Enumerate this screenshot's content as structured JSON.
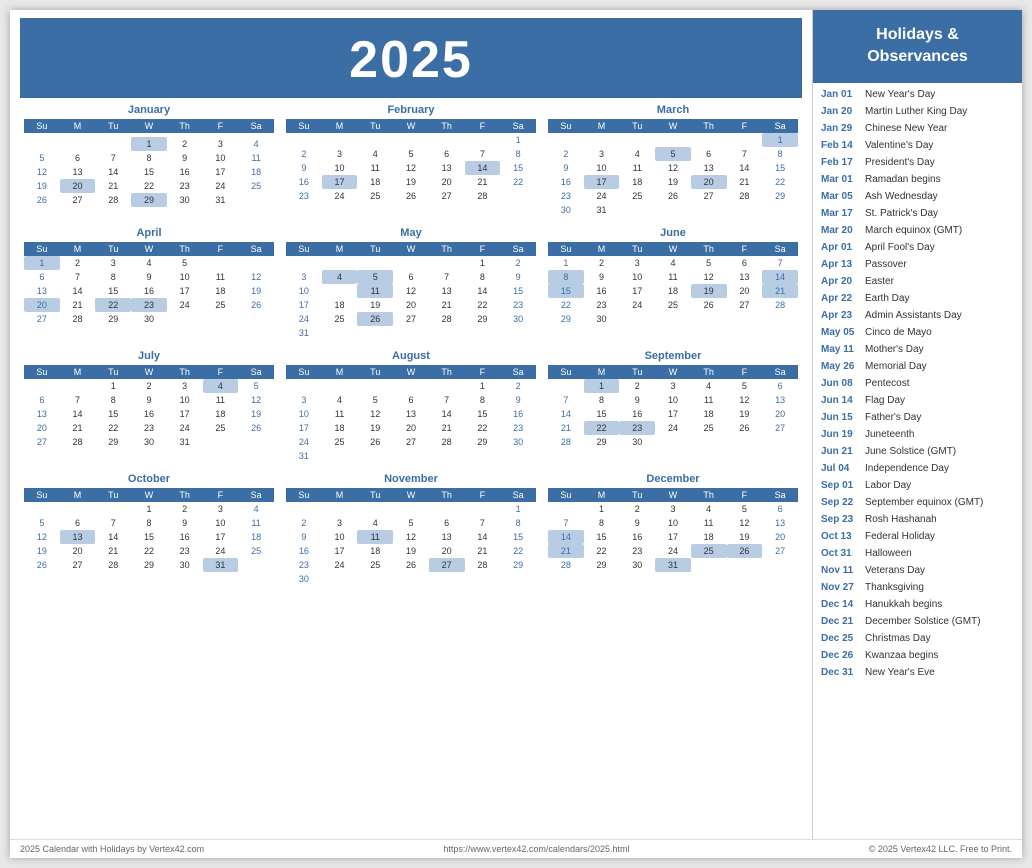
{
  "year": "2025",
  "sidebar": {
    "header": "Holidays &\nObservances",
    "holidays": [
      {
        "date": "Jan 01",
        "name": "New Year's Day"
      },
      {
        "date": "Jan 20",
        "name": "Martin Luther King Day"
      },
      {
        "date": "Jan 29",
        "name": "Chinese New Year"
      },
      {
        "date": "Feb 14",
        "name": "Valentine's Day"
      },
      {
        "date": "Feb 17",
        "name": "President's Day"
      },
      {
        "date": "Mar 01",
        "name": "Ramadan begins"
      },
      {
        "date": "Mar 05",
        "name": "Ash Wednesday"
      },
      {
        "date": "Mar 17",
        "name": "St. Patrick's Day"
      },
      {
        "date": "Mar 20",
        "name": "March equinox (GMT)"
      },
      {
        "date": "Apr 01",
        "name": "April Fool's Day"
      },
      {
        "date": "Apr 13",
        "name": "Passover"
      },
      {
        "date": "Apr 20",
        "name": "Easter"
      },
      {
        "date": "Apr 22",
        "name": "Earth Day"
      },
      {
        "date": "Apr 23",
        "name": "Admin Assistants Day"
      },
      {
        "date": "May 05",
        "name": "Cinco de Mayo"
      },
      {
        "date": "May 11",
        "name": "Mother's Day"
      },
      {
        "date": "May 26",
        "name": "Memorial Day"
      },
      {
        "date": "Jun 08",
        "name": "Pentecost"
      },
      {
        "date": "Jun 14",
        "name": "Flag Day"
      },
      {
        "date": "Jun 15",
        "name": "Father's Day"
      },
      {
        "date": "Jun 19",
        "name": "Juneteenth"
      },
      {
        "date": "Jun 21",
        "name": "June Solstice (GMT)"
      },
      {
        "date": "Jul 04",
        "name": "Independence Day"
      },
      {
        "date": "Sep 01",
        "name": "Labor Day"
      },
      {
        "date": "Sep 22",
        "name": "September equinox (GMT)"
      },
      {
        "date": "Sep 23",
        "name": "Rosh Hashanah"
      },
      {
        "date": "Oct 13",
        "name": "Federal Holiday"
      },
      {
        "date": "Oct 31",
        "name": "Halloween"
      },
      {
        "date": "Nov 11",
        "name": "Veterans Day"
      },
      {
        "date": "Nov 27",
        "name": "Thanksgiving"
      },
      {
        "date": "Dec 14",
        "name": "Hanukkah begins"
      },
      {
        "date": "Dec 21",
        "name": "December Solstice (GMT)"
      },
      {
        "date": "Dec 25",
        "name": "Christmas Day"
      },
      {
        "date": "Dec 26",
        "name": "Kwanzaa begins"
      },
      {
        "date": "Dec 31",
        "name": "New Year's Eve"
      }
    ]
  },
  "footer": {
    "left": "2025 Calendar with Holidays by Vertex42.com",
    "center": "https://www.vertex42.com/calendars/2025.html",
    "right": "© 2025 Vertex42 LLC. Free to Print."
  }
}
